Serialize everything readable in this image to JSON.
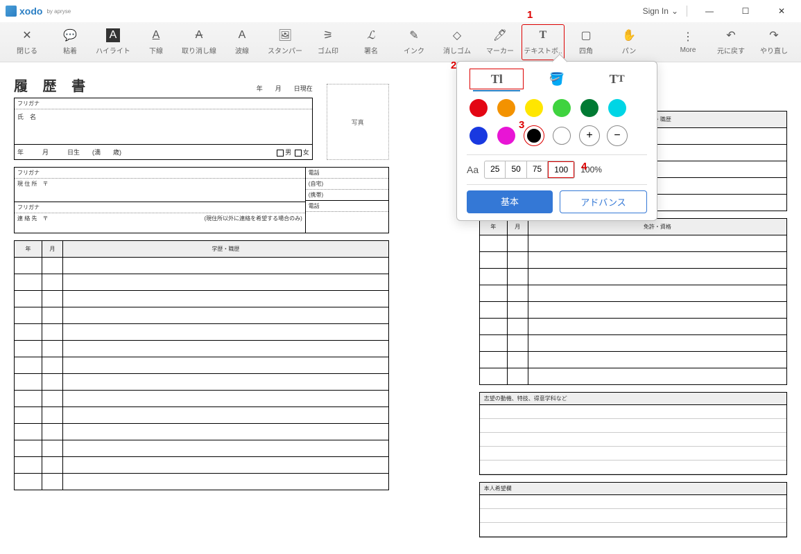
{
  "titlebar": {
    "brand": "xodo",
    "byline": "by apryse",
    "signin": "Sign In"
  },
  "toolbar": {
    "close": "閉じる",
    "sticky": "粘着",
    "highlight": "ハイライト",
    "underline": "下線",
    "strikeout": "取り消し線",
    "squiggly": "波線",
    "stamp": "スタンパー",
    "rubber": "ゴム印",
    "signature": "署名",
    "ink": "インク",
    "eraser": "消しゴム",
    "marker": "マーカー",
    "textbox": "テキストボ..",
    "square": "四角",
    "pan": "パン",
    "more": "More",
    "undo": "元に戻す",
    "redo": "やり直し"
  },
  "popup": {
    "label_aa": "Aa",
    "opacities": [
      "25",
      "50",
      "75",
      "100"
    ],
    "percent": "100%",
    "basic": "基本",
    "advanced": "アドバンス",
    "colors": [
      "#e30613",
      "#f39200",
      "#ffe600",
      "#3fd33f",
      "#007a33",
      "#00d5e5",
      "#1939e0",
      "#e815d5",
      "#000000",
      "#ffffff"
    ]
  },
  "doc": {
    "title": "履 歴 書",
    "date_suffix": "年　　月　　日現在",
    "furigana": "フリガナ",
    "shimei": "氏　名",
    "photo": "写真",
    "dob": "年　　　月　　　日生　　(満　　歳)",
    "male": "男",
    "female": "女",
    "genjusho": "現 住 所　〒",
    "denwa": "電話",
    "jitaku": "(自宅)",
    "keitai": "(携帯)",
    "renrakusaki": "連 絡 先　〒",
    "renraku_note": "(現住所以外に連絡を希望する場合のみ)",
    "col_year": "年",
    "col_month": "月",
    "col_history": "学歴・職歴",
    "col_license": "免許・資格",
    "motivation": "志望の動機、特技、得意学科など",
    "wishes": "本人希望欄"
  },
  "callouts": {
    "c1": "1",
    "c2": "2",
    "c3": "3",
    "c4": "4"
  }
}
